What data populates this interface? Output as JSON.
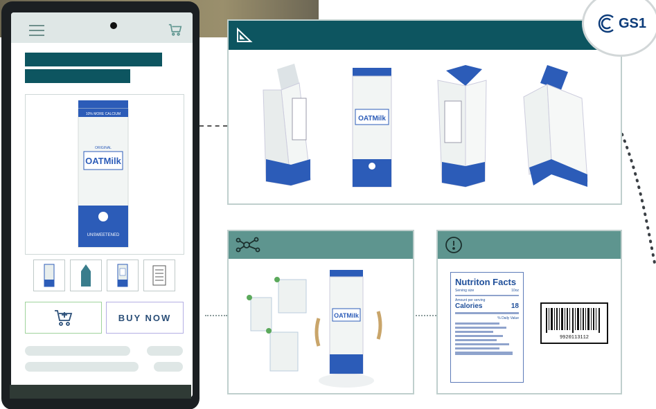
{
  "app": {
    "product_brand": "OATMilk",
    "buy_button_label": "BUY NOW",
    "brand_logo": "GS1"
  },
  "carton": {
    "top_label": "10% MORE CALCIUM",
    "variant": "ORIGINAL",
    "name": "OATMilk",
    "claims": "DAIRY FREE\nNON GMO NON GMO",
    "bottom_label": "UNSWEETENED"
  },
  "nutrition": {
    "title": "Nutriton Facts",
    "servings_label": "Serving size",
    "servings_value": "10oz",
    "amount_label": "Amount per serving",
    "calories_label": "Calories",
    "calories_value": "18",
    "dv_label": "% Daily Value"
  },
  "barcode": {
    "number": "9920113112"
  },
  "icons": {
    "panel_3d": "ruler-triangle-icon",
    "panel_network": "network-nodes-icon",
    "panel_info": "alert-circle-icon",
    "menu": "hamburger-icon",
    "cart": "cart-icon",
    "add_to_cart": "add-to-cart-icon"
  },
  "colors": {
    "primary": "#0d5560",
    "secondary": "#5e958f",
    "carton_blue": "#2c5cb8",
    "add_border": "#9fd39b",
    "buy_border": "#b3aee3"
  }
}
